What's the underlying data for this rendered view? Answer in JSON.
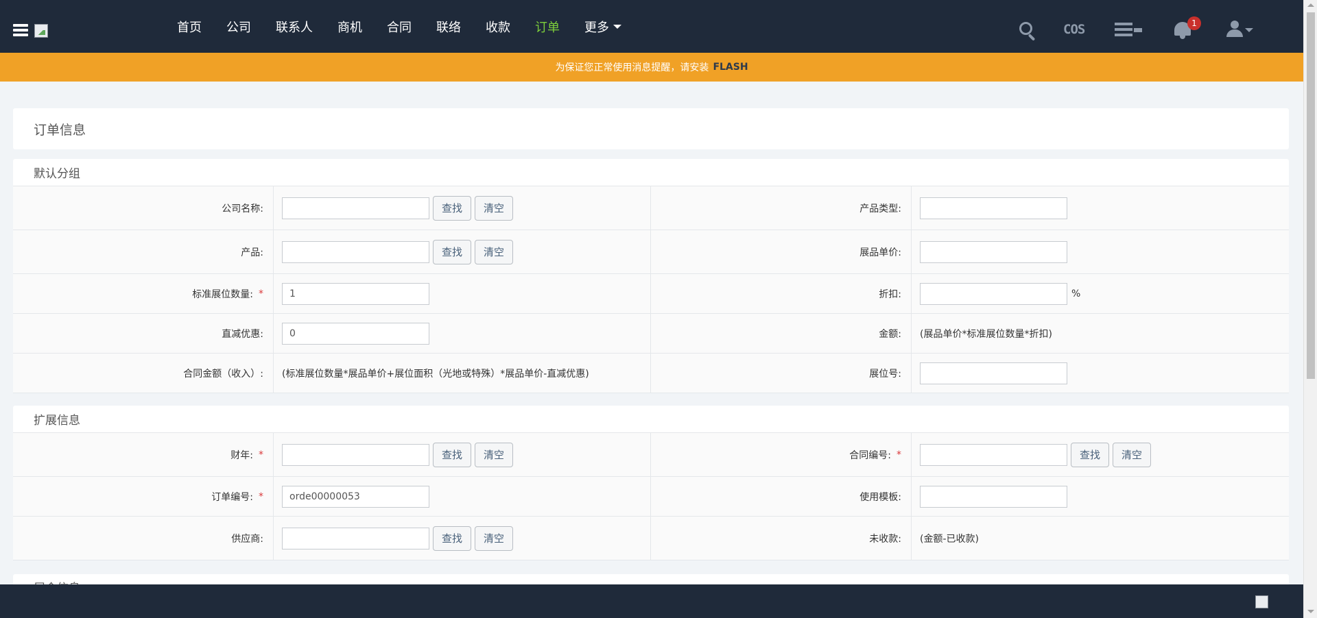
{
  "nav": {
    "items": [
      {
        "label": "首页",
        "active": false
      },
      {
        "label": "公司",
        "active": false
      },
      {
        "label": "联系人",
        "active": false
      },
      {
        "label": "商机",
        "active": false
      },
      {
        "label": "合同",
        "active": false
      },
      {
        "label": "联络",
        "active": false
      },
      {
        "label": "收款",
        "active": false
      },
      {
        "label": "订单",
        "active": true
      },
      {
        "label": "更多",
        "active": false
      }
    ],
    "cos_label": "COS",
    "notification_count": "1",
    "active_color": "#7dcf3b"
  },
  "alert": {
    "text": "为保证您正常使用消息提醒，请安装",
    "emphasis": "FLASH"
  },
  "page": {
    "title": "订单信息"
  },
  "buttons": {
    "find": "查找",
    "clear": "清空"
  },
  "section_default": {
    "title": "默认分组",
    "company_name_label": "公司名称:",
    "product_type_label": "产品类型:",
    "product_label": "产品:",
    "unit_price_label": "展品单价:",
    "booth_qty_label": "标准展位数量:",
    "booth_qty_value": "1",
    "discount_label": "折扣:",
    "discount_unit": "%",
    "reduction_label": "直减优惠:",
    "reduction_value": "0",
    "amount_label": "金额:",
    "amount_formula": "(展品单价*标准展位数量*折扣)",
    "contract_amount_label": "合同金额（收入）:",
    "contract_amount_formula": "(标准展位数量*展品单价+展位面积（光地或特殊）*展品单价-直减优惠)",
    "booth_no_label": "展位号:"
  },
  "section_extended": {
    "title": "扩展信息",
    "fiscal_year_label": "财年:",
    "contract_no_label": "合同编号:",
    "order_no_label": "订单编号:",
    "order_no_value": "orde00000053",
    "template_label": "使用模板:",
    "supplier_label": "供应商:",
    "unpaid_label": "未收款:",
    "unpaid_formula": "(金额-已收款)"
  },
  "section_next": {
    "title": "展会信息"
  },
  "required_mark": "*"
}
